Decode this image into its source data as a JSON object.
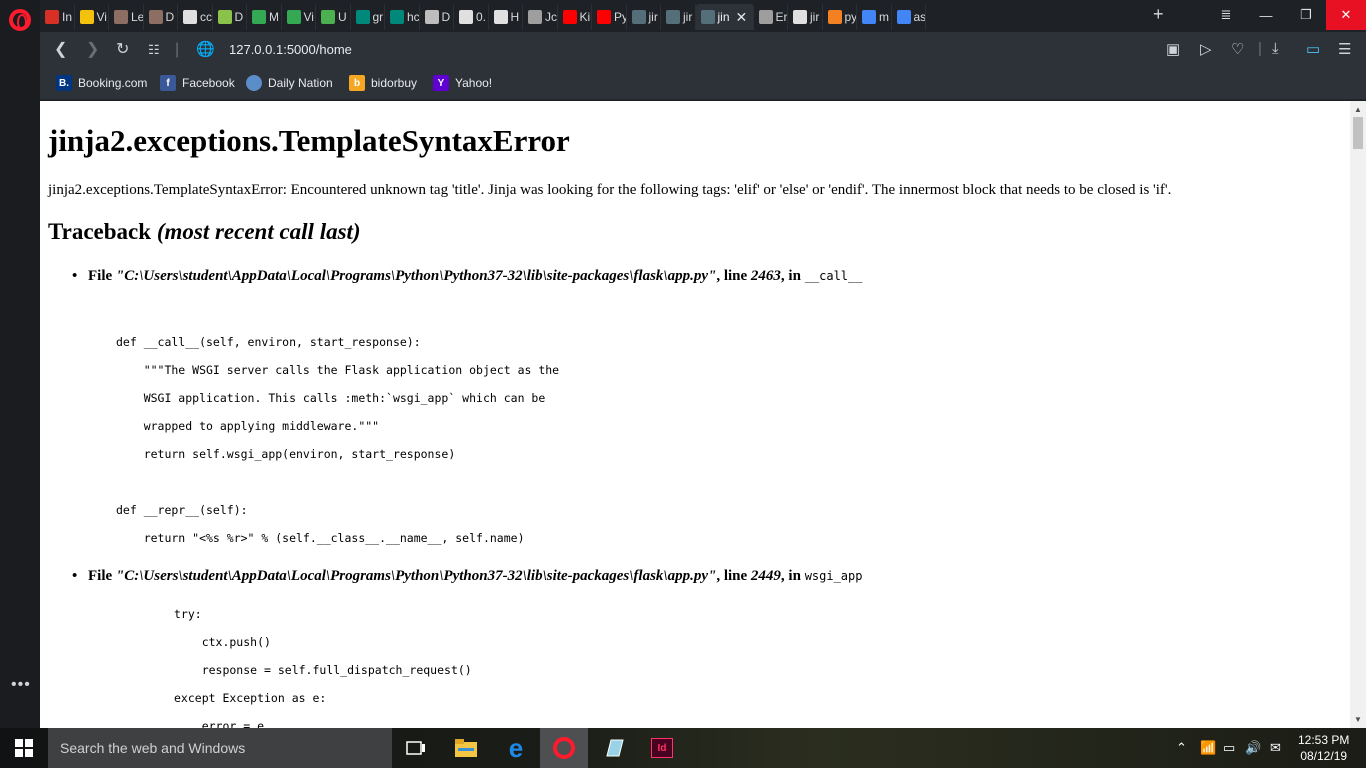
{
  "tabs": [
    {
      "label": "In",
      "icon": "gmail-icon",
      "color": "#d93025"
    },
    {
      "label": "Vi",
      "icon": "folder-icon",
      "color": "#f4c20d"
    },
    {
      "label": "Le",
      "icon": "site-icon",
      "color": "#8d6e63"
    },
    {
      "label": "D",
      "icon": "site-icon",
      "color": "#8d6e63"
    },
    {
      "label": "cc",
      "icon": "page-icon",
      "color": "#e0e0e0"
    },
    {
      "label": "D",
      "icon": "dots-icon",
      "color": "#8bc34a"
    },
    {
      "label": "M",
      "icon": "drive-icon",
      "color": "#34a853"
    },
    {
      "label": "Vi",
      "icon": "drive-icon",
      "color": "#34a853"
    },
    {
      "label": "U",
      "icon": "recycle-icon",
      "color": "#4caf50"
    },
    {
      "label": "gr",
      "icon": "bing-icon",
      "color": "#00897b"
    },
    {
      "label": "hc",
      "icon": "bing-icon",
      "color": "#00897b"
    },
    {
      "label": "D",
      "icon": "phone-icon",
      "color": "#bdbdbd"
    },
    {
      "label": "0.",
      "icon": "page-icon",
      "color": "#e0e0e0"
    },
    {
      "label": "H",
      "icon": "clock-icon",
      "color": "#e0e0e0"
    },
    {
      "label": "Jc",
      "icon": "image-icon",
      "color": "#9e9e9e"
    },
    {
      "label": "Ki",
      "icon": "youtube-icon",
      "color": "#ff0000"
    },
    {
      "label": "Py",
      "icon": "youtube-icon",
      "color": "#ff0000"
    },
    {
      "label": "jir",
      "icon": "terminal-icon",
      "color": "#546e7a"
    },
    {
      "label": "jir",
      "icon": "terminal-icon",
      "color": "#546e7a"
    },
    {
      "label": "jin",
      "icon": "terminal-icon",
      "color": "#546e7a",
      "active": true
    },
    {
      "label": "Er",
      "icon": "loading-icon",
      "color": "#9e9e9e"
    },
    {
      "label": "jir",
      "icon": "page-icon",
      "color": "#e0e0e0"
    },
    {
      "label": "py",
      "icon": "stackoverflow-icon",
      "color": "#f48024"
    },
    {
      "label": "m",
      "icon": "google-icon",
      "color": "#4285f4"
    },
    {
      "label": "as",
      "icon": "google-icon",
      "color": "#4285f4"
    }
  ],
  "address": {
    "url_host": "127.0.0.1",
    "url_path": ":5000/home"
  },
  "bookmarks": [
    {
      "label": "Booking.com",
      "icon": "booking-icon",
      "icon_text": "B.",
      "color": "#003580"
    },
    {
      "label": "Facebook",
      "icon": "facebook-icon",
      "icon_text": "f",
      "color": "#3b5998"
    },
    {
      "label": "Daily Nation",
      "icon": "globe-icon",
      "icon_text": "",
      "color": "#5b8ec9"
    },
    {
      "label": "bidorbuy",
      "icon": "bidorbuy-icon",
      "icon_text": "b",
      "color": "#f5a623"
    },
    {
      "label": "Yahoo!",
      "icon": "yahoo-icon",
      "icon_text": "Y",
      "color": "#5f01d1"
    }
  ],
  "page": {
    "title": "jinja2.exceptions.TemplateSyntaxError",
    "message": "jinja2.exceptions.TemplateSyntaxError: Encountered unknown tag 'title'. Jinja was looking for the following tags: 'elif' or 'else' or 'endif'. The innermost block that needs to be closed is 'if'.",
    "traceback_label": "Traceback",
    "traceback_sub": "(most recent call last)",
    "frames": [
      {
        "prefix": "File",
        "path": "\"C:\\Users\\student\\AppData\\Local\\Programs\\Python\\Python37-32\\lib\\site-packages\\flask\\app.py\"",
        "line_label": ", line",
        "line_no": "2463",
        "in_label": ", in",
        "func": "__call__"
      },
      {
        "prefix": "File",
        "path": "\"C:\\Users\\student\\AppData\\Local\\Programs\\Python\\Python37-32\\lib\\site-packages\\flask\\app.py\"",
        "line_label": ", line",
        "line_no": "2449",
        "in_label": ", in",
        "func": "wsgi_app"
      }
    ],
    "code1": [
      "def __call__(self, environ, start_response):",
      "    \"\"\"The WSGI server calls the Flask application object as the",
      "    WSGI application. This calls :meth:`wsgi_app` which can be",
      "    wrapped to applying middleware.\"\"\"",
      "    return self.wsgi_app(environ, start_response)",
      "",
      "def __repr__(self):",
      "    return \"<%s %r>\" % (self.__class__.__name__, self.name)"
    ],
    "code2": [
      "try:",
      "    ctx.push()",
      "    response = self.full_dispatch_request()",
      "except Exception as e:",
      "    error = e"
    ]
  },
  "taskbar": {
    "search_placeholder": "Search the web and Windows",
    "time": "12:53 PM",
    "date": "08/12/19"
  }
}
